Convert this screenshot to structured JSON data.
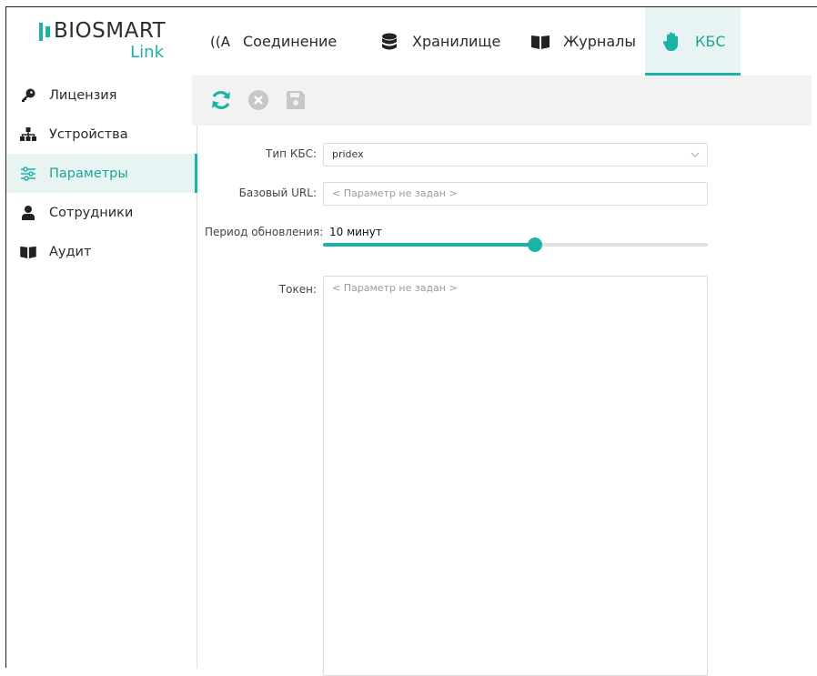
{
  "brand": {
    "name": "BIOSMART",
    "sub": "Link",
    "color": "#1bb3a5"
  },
  "topnav": {
    "tabs": [
      {
        "label": "Соединение",
        "icon": "antenna-icon"
      },
      {
        "label": "Хранилище",
        "icon": "database-icon"
      },
      {
        "label": "Журналы",
        "icon": "book-icon"
      },
      {
        "label": "КБС",
        "icon": "hand-icon",
        "active": true
      }
    ]
  },
  "sidebar": {
    "items": [
      {
        "label": "Лицензия",
        "icon": "key-icon"
      },
      {
        "label": "Устройства",
        "icon": "hierarchy-icon"
      },
      {
        "label": "Параметры",
        "icon": "sliders-icon",
        "active": true
      },
      {
        "label": "Сотрудники",
        "icon": "user-icon"
      },
      {
        "label": "Аудит",
        "icon": "book-icon"
      }
    ]
  },
  "toolbar": {
    "refresh_icon": "refresh-icon",
    "cancel_icon": "cancel-icon",
    "save_icon": "save-icon"
  },
  "form": {
    "kbs_type": {
      "label": "Тип КБС:",
      "value": "pridex"
    },
    "base_url": {
      "label": "Базовый URL:",
      "placeholder": "< Параметр не задан >"
    },
    "period": {
      "label": "Период обновления:",
      "value": "10 минут",
      "slider_fraction": 0.55
    },
    "token": {
      "label": "Токен:",
      "placeholder": "< Параметр не задан >"
    }
  }
}
